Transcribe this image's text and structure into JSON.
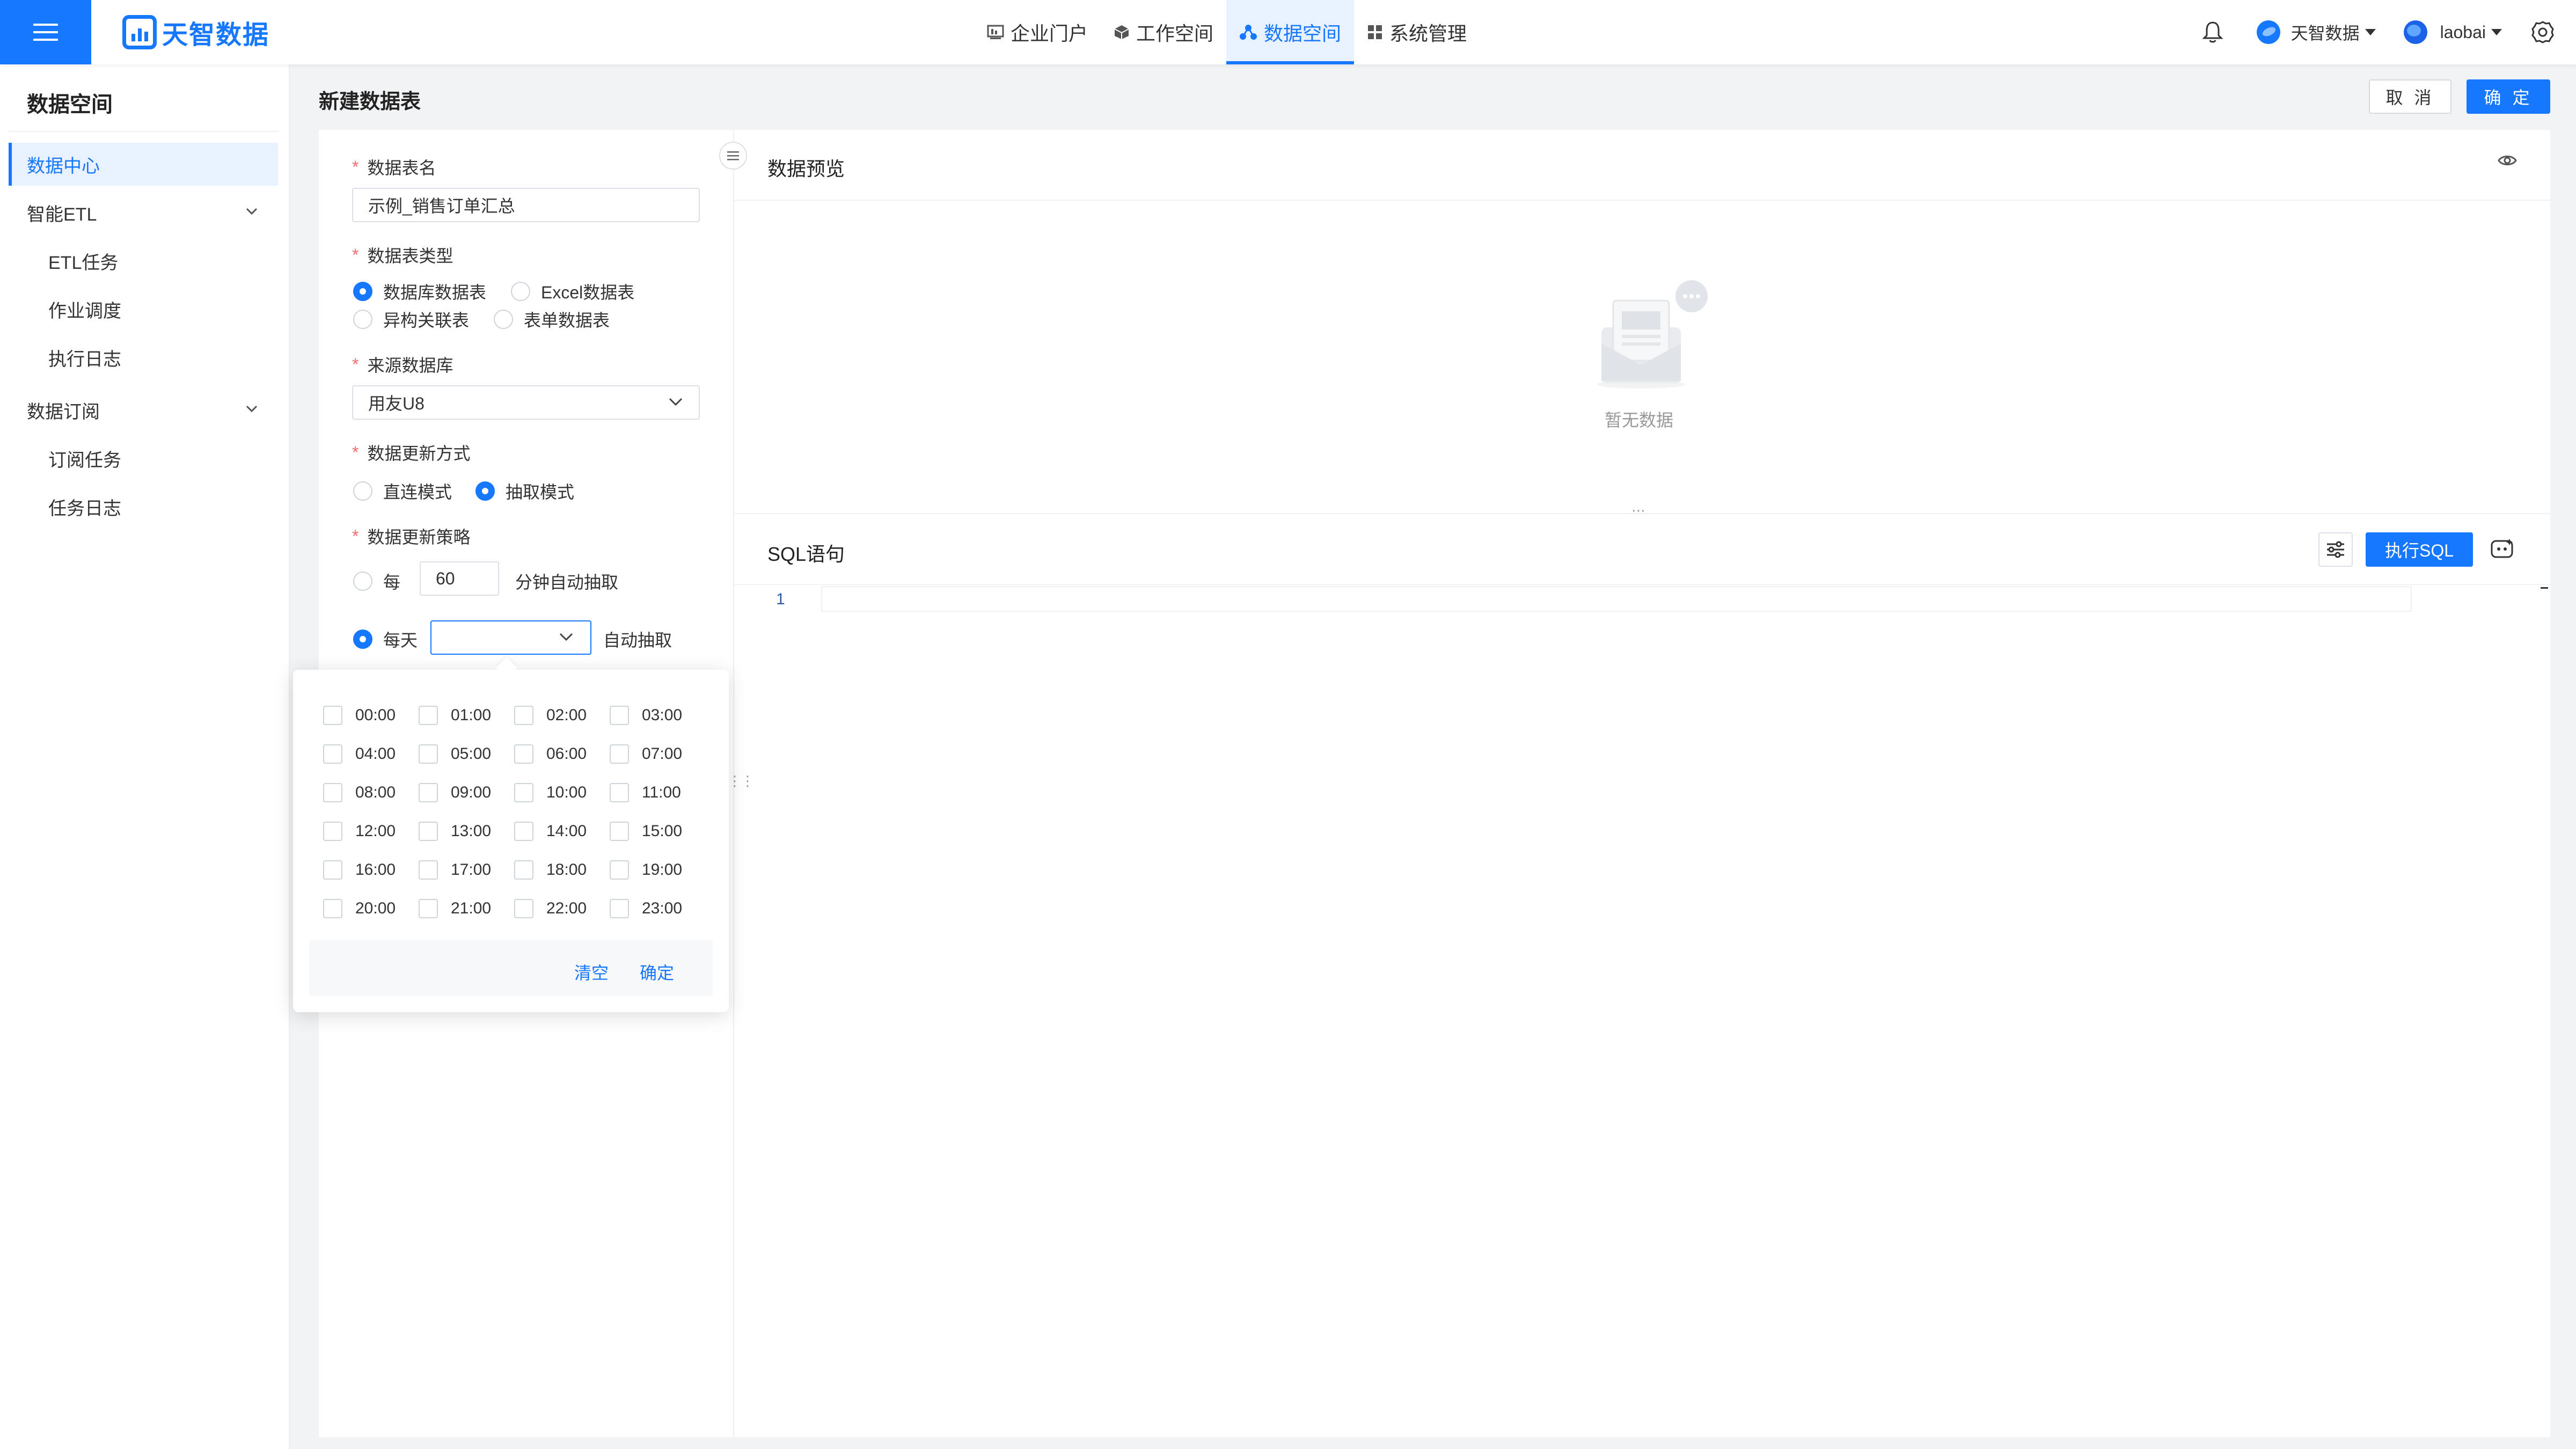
{
  "brand": {
    "name": "天智数据",
    "color": "#1677ff"
  },
  "nav": {
    "items": [
      {
        "label": "企业门户",
        "icon": "portal-icon"
      },
      {
        "label": "工作空间",
        "icon": "cube-icon"
      },
      {
        "label": "数据空间",
        "icon": "data-space-icon",
        "active": true
      },
      {
        "label": "系统管理",
        "icon": "grid-icon"
      }
    ]
  },
  "header": {
    "org_name": "天智数据",
    "username": "laobai"
  },
  "sidebar": {
    "title": "数据空间",
    "items": [
      {
        "label": "数据中心",
        "active": true
      },
      {
        "label": "智能ETL",
        "expandable": true
      },
      {
        "label": "ETL任务",
        "sub": true
      },
      {
        "label": "作业调度",
        "sub": true
      },
      {
        "label": "执行日志",
        "sub": true
      },
      {
        "label": "数据订阅",
        "expandable": true
      },
      {
        "label": "订阅任务",
        "sub": true
      },
      {
        "label": "任务日志",
        "sub": true
      }
    ]
  },
  "page": {
    "title": "新建数据表",
    "cancel_label": "取 消",
    "confirm_label": "确 定"
  },
  "form": {
    "table_name_label": "数据表名",
    "table_name_value": "示例_销售订单汇总",
    "table_type_label": "数据表类型",
    "table_type_options": [
      "数据库数据表",
      "Excel数据表",
      "异构关联表",
      "表单数据表"
    ],
    "table_type_selected": "数据库数据表",
    "source_db_label": "来源数据库",
    "source_db_value": "用友U8",
    "update_mode_label": "数据更新方式",
    "update_mode_options": [
      "直连模式",
      "抽取模式"
    ],
    "update_mode_selected": "抽取模式",
    "update_strategy_label": "数据更新策略",
    "every_label": "每",
    "every_minutes_value": "60",
    "every_minutes_suffix": "分钟自动抽取",
    "daily_label": "每天",
    "daily_value": "",
    "daily_suffix": "自动抽取",
    "daily_selected": true
  },
  "time_picker": {
    "times": [
      "00:00",
      "01:00",
      "02:00",
      "03:00",
      "04:00",
      "05:00",
      "06:00",
      "07:00",
      "08:00",
      "09:00",
      "10:00",
      "11:00",
      "12:00",
      "13:00",
      "14:00",
      "15:00",
      "16:00",
      "17:00",
      "18:00",
      "19:00",
      "20:00",
      "21:00",
      "22:00",
      "23:00"
    ],
    "checked": [],
    "clear_label": "清空",
    "confirm_label": "确定"
  },
  "preview": {
    "title": "数据预览",
    "empty_text": "暂无数据"
  },
  "sql": {
    "title": "SQL语句",
    "execute_label": "执行SQL",
    "lines": [
      "1"
    ]
  }
}
